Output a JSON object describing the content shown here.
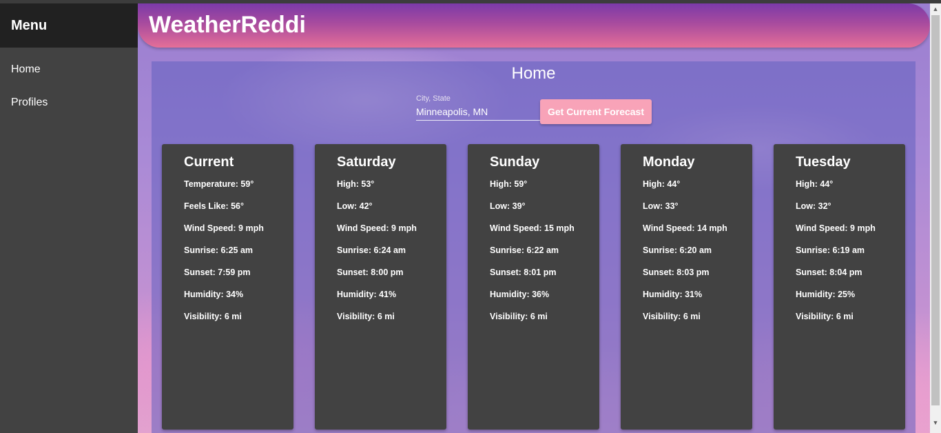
{
  "sidebar": {
    "header": "Menu",
    "items": [
      {
        "label": "Home"
      },
      {
        "label": "Profiles"
      }
    ]
  },
  "app": {
    "title": "WeatherReddi"
  },
  "page": {
    "heading": "Home"
  },
  "search": {
    "label": "City, State",
    "value": "Minneapolis, MN",
    "button_label": "Get Current Forecast"
  },
  "colors": {
    "appbar_start": "#7b3aa8",
    "appbar_end": "#e46f98",
    "button": "#f8a3b8",
    "card": "#424242",
    "sidebar": "#424242",
    "sidebar_header": "#212121"
  },
  "cards": [
    {
      "title": "Current",
      "stats": [
        "Temperature: 59°",
        "Feels Like: 56°",
        "Wind Speed: 9 mph",
        "Sunrise: 6:25 am",
        "Sunset: 7:59 pm",
        "Humidity: 34%",
        "Visibility: 6 mi"
      ]
    },
    {
      "title": "Saturday",
      "stats": [
        "High: 53°",
        "Low: 42°",
        "Wind Speed: 9 mph",
        "Sunrise: 6:24 am",
        "Sunset: 8:00 pm",
        "Humidity: 41%",
        "Visibility: 6 mi"
      ]
    },
    {
      "title": "Sunday",
      "stats": [
        "High: 59°",
        "Low: 39°",
        "Wind Speed: 15 mph",
        "Sunrise: 6:22 am",
        "Sunset: 8:01 pm",
        "Humidity: 36%",
        "Visibility: 6 mi"
      ]
    },
    {
      "title": "Monday",
      "stats": [
        "High: 44°",
        "Low: 33°",
        "Wind Speed: 14 mph",
        "Sunrise: 6:20 am",
        "Sunset: 8:03 pm",
        "Humidity: 31%",
        "Visibility: 6 mi"
      ]
    },
    {
      "title": "Tuesday",
      "stats": [
        "High: 44°",
        "Low: 32°",
        "Wind Speed: 9 mph",
        "Sunrise: 6:19 am",
        "Sunset: 8:04 pm",
        "Humidity: 25%",
        "Visibility: 6 mi"
      ]
    }
  ]
}
